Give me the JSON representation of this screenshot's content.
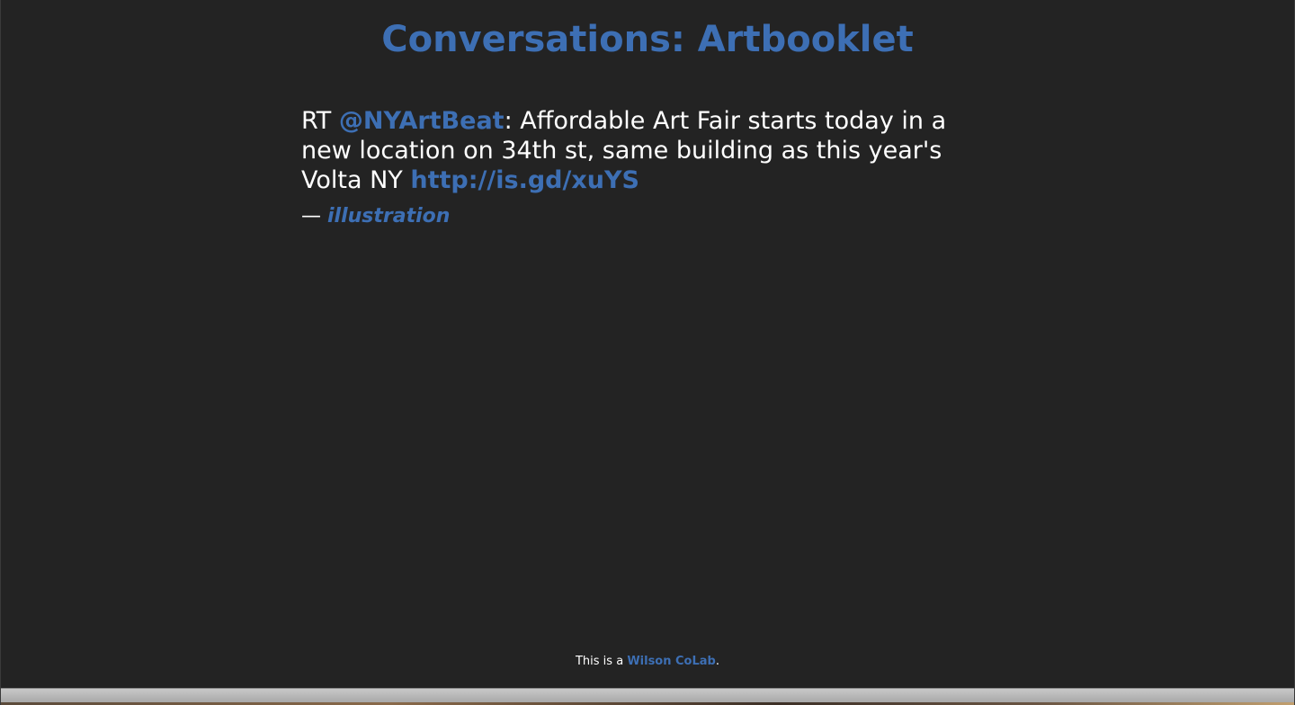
{
  "page": {
    "title": "Conversations: Artbooklet"
  },
  "tweet": {
    "prefix": "RT ",
    "mention": "@NYArtBeat",
    "text": ": Affordable Art Fair starts today in a new location on 34th st, same building as this year's Volta NY ",
    "link": "http://is.gd/xuYS"
  },
  "attribution": {
    "dash": "— ",
    "author": "illustration"
  },
  "footer": {
    "prefix": "This is a ",
    "link_label": "Wilson CoLab",
    "suffix": "."
  },
  "colors": {
    "background": "#232323",
    "accent": "#3d6fb4",
    "text": "#ffffff"
  }
}
